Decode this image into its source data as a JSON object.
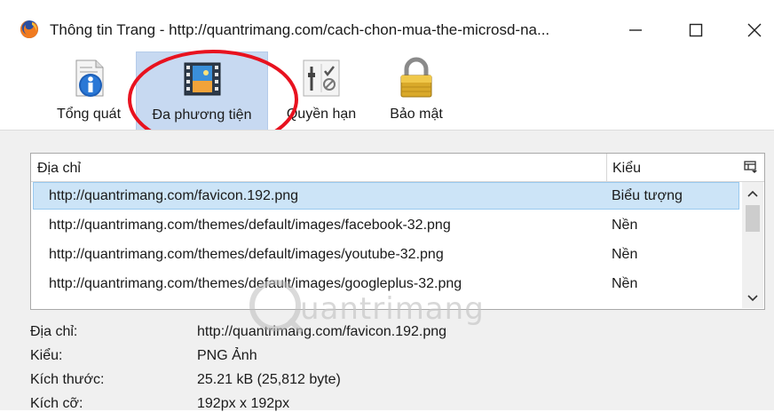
{
  "window": {
    "title": "Thông tin Trang - http://quantrimang.com/cach-chon-mua-the-microsd-na...",
    "controls": {
      "minimize": "—",
      "maximize": "☐",
      "close": "✕"
    }
  },
  "toolbar": {
    "items": [
      {
        "label": "Tổng quát",
        "icon": "info-icon",
        "selected": false
      },
      {
        "label": "Đa phương tiện",
        "icon": "media-icon",
        "selected": true
      },
      {
        "label": "Quyền hạn",
        "icon": "permissions-icon",
        "selected": false
      },
      {
        "label": "Bảo mật",
        "icon": "lock-icon",
        "selected": false
      }
    ]
  },
  "media_list": {
    "columns": {
      "address": "Địa chỉ",
      "type": "Kiểu"
    },
    "rows": [
      {
        "address": "http://quantrimang.com/favicon.192.png",
        "type": "Biểu tượng",
        "selected": true
      },
      {
        "address": "http://quantrimang.com/themes/default/images/facebook-32.png",
        "type": "Nền",
        "selected": false
      },
      {
        "address": "http://quantrimang.com/themes/default/images/youtube-32.png",
        "type": "Nền",
        "selected": false
      },
      {
        "address": "http://quantrimang.com/themes/default/images/googleplus-32.png",
        "type": "Nền",
        "selected": false
      }
    ]
  },
  "details": [
    {
      "key": "Địa chỉ:",
      "value": "http://quantrimang.com/favicon.192.png"
    },
    {
      "key": "Kiểu:",
      "value": "PNG Ảnh"
    },
    {
      "key": "Kích thước:",
      "value": "25.21 kB (25,812 byte)"
    },
    {
      "key": "Kích cỡ:",
      "value": "192px x 192px"
    }
  ],
  "watermark": "uantrimang",
  "colors": {
    "selected_tab_bg": "#c7d9f1",
    "selected_row_bg": "#cce4f7",
    "annotation_red": "#e8121f",
    "panel_bg": "#f0f0f0"
  }
}
